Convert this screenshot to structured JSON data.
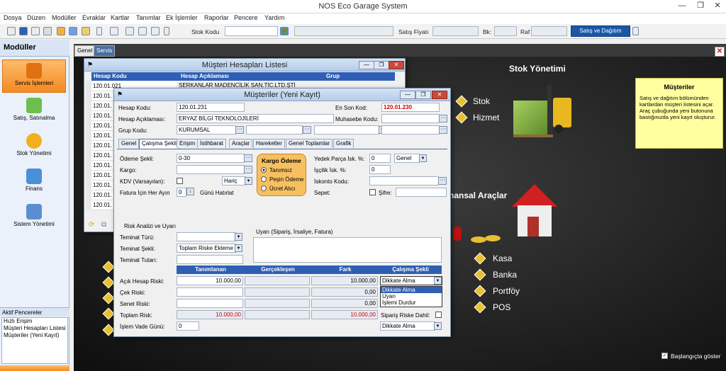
{
  "app_title": "NOS Eco Garage System",
  "window_controls": {
    "minimize": "—",
    "restore": "❐",
    "close": "✕"
  },
  "menu": [
    "Dosya",
    "Düzen",
    "Modüller",
    "Evraklar",
    "Kartlar",
    "Tanımlar",
    "Ek İşlemler",
    "Raporlar",
    "Pencere",
    "Yardım"
  ],
  "toolbar": {
    "stok_kodu_label": "Stok Kodu",
    "satis_fiyati_label": "Satış Fiyatı",
    "bk_label": "Bk:",
    "raf_label": "Raf",
    "satis_dagitim_button": "Satış ve Dağıtım"
  },
  "sidebar": {
    "title": "Modüller",
    "modules": [
      {
        "label": "Servis İşlemleri",
        "active": true
      },
      {
        "label": "Satış, Satınalma"
      },
      {
        "label": "Stok Yönetimi"
      },
      {
        "label": "Finans"
      },
      {
        "label": "Sistem Yönetimi"
      }
    ],
    "active_windows_title": "Aktif Pencereler",
    "active_windows": [
      "Hızlı Erişim",
      "Müşteri Hesapları Listesi",
      "Müşteriler (Yeni Kayıt)"
    ]
  },
  "workarea_tabs": [
    "Genel",
    "Servis"
  ],
  "dashboard": {
    "stok_title": "Stok Yönetimi",
    "stok_items": [
      "Stok",
      "Hizmet"
    ],
    "finans_title": "nansal Araçlar",
    "finans_items": [
      "Kasa",
      "Banka",
      "Portföy",
      "POS"
    ],
    "info_title": "Müşteriler",
    "info_text": "Satış ve dağıtım bölümünden kartlardan müşteri listesini açar. Araç çubuğunda yeni butonuna bastığınızda yeni kayıt oluşturur.",
    "show_at_start": "Başlangıçta göster"
  },
  "list_window": {
    "title": "Müşteri Hesapları Listesi",
    "columns": [
      "Hesap Kodu",
      "Hesap Açıklaması",
      "Grup"
    ],
    "rows": [
      {
        "code": "120.01.021",
        "desc": "SERKANLAR MADENCİLİK SAN.TİC.LTD.ŞTİ"
      },
      {
        "code": "120.01.",
        "desc": ""
      },
      {
        "code": "120.01.",
        "desc": ""
      },
      {
        "code": "120.01.",
        "desc": ""
      },
      {
        "code": "120.01.",
        "desc": ""
      },
      {
        "code": "120.01.",
        "desc": ""
      },
      {
        "code": "120.01.",
        "desc": ""
      },
      {
        "code": "120.01.",
        "desc": ""
      },
      {
        "code": "120.01.",
        "desc": ""
      },
      {
        "code": "120.01.",
        "desc": ""
      },
      {
        "code": "120.01.",
        "desc": ""
      },
      {
        "code": "120.01.",
        "desc": ""
      },
      {
        "code": "120.01.",
        "desc": ""
      }
    ]
  },
  "form": {
    "title": "Müşteriler (Yeni Kayıt)",
    "hesap_kodu_label": "Hesap Kodu:",
    "hesap_kodu": "120.01.231",
    "en_son_kod_label": "En Son Kod:",
    "en_son_kod": "120.01.230",
    "hesap_aciklamasi_label": "Hesap Açıklaması:",
    "hesap_aciklamasi": "ERYAZ BİLGİ TEKNOLOJİLERİ",
    "muhasebe_kodu_label": "Muhasebe Kodu:",
    "grup_kodu_label": "Grup Kodu:",
    "grup_kodu": "KURUMSAL",
    "tabs": [
      "Genel",
      "Çalışma Şekli",
      "Erişim",
      "İstihbarat",
      "Araçlar",
      "Hareketler",
      "Genel Toplamlar",
      "Grafik"
    ],
    "odeme_sekli_label": "Ödeme Şekli:",
    "odeme_sekli": "0-30",
    "kargo_label": "Kargo:",
    "kdv_label": "KDV (Varsayılan):",
    "kdv_value": "Hariç",
    "fatura_label": "Fatura İçin Her Ayın",
    "fatura_value": "0",
    "gunu_label": "Günü Hatırlat",
    "kargo_odeme_title": "Kargo Ödeme",
    "kargo_options": [
      "Tanımsız",
      "Peşin Ödeme",
      "Ücret Alıcı"
    ],
    "yedek_parca_label": "Yedek Parça İsk. %:",
    "yedek_parca": "0",
    "yedek_parca_type": "Genel",
    "iscilik_label": "İşçilik İsk. %:",
    "iscilik": "0",
    "iskonto_label": "İskonto Kodu:",
    "sepet_label": "Sepet:",
    "sifre_label": "Şifre:",
    "risk_title": "Risk Analizi ve Uyarı",
    "teminat_turu_label": "Teminat Türü:",
    "teminat_sekli_label": "Teminat Şekli:",
    "teminat_sekli": "Toplam Riske Ekleme",
    "teminat_tutari_label": "Teminat Tutarı:",
    "uyari_label": "Uyarı (Sipariş, İrsaliye, Fatura)",
    "risk_columns": [
      "Tanımlanan",
      "Gerçekleşen",
      "Fark",
      "Çalışma Şekli"
    ],
    "risk_rows": [
      {
        "label": "Açık Hesap Riski:",
        "tanimlanan": "10.000,00",
        "fark": "10.000,00",
        "sekil": "Dikkate Alma"
      },
      {
        "label": "Çek Riski:",
        "tanimlanan": "",
        "fark": "0,00"
      },
      {
        "label": "Senet Riski:",
        "tanimlanan": "",
        "fark": "0,00"
      },
      {
        "label": "Toplam Risk:",
        "tanimlanan": "10.000,00",
        "fark": "10.000,00"
      }
    ],
    "dropdown_options": [
      "Dikkate Alma",
      "Uyarı",
      "İşlemi Durdur"
    ],
    "siparis_riske_label": "Sipariş Riske Dahil:",
    "islem_vade_label": "İşlem Vade Günü:",
    "islem_vade": "0",
    "islem_sekil": "Dikkate Alma"
  }
}
